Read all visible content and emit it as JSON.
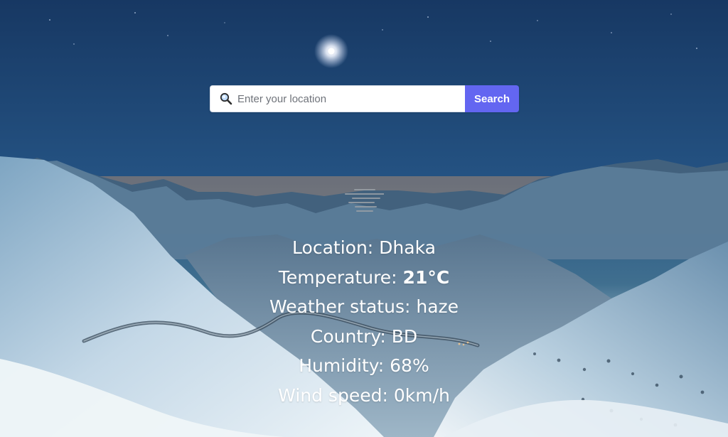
{
  "search": {
    "placeholder": "Enter your location",
    "button_label": "Search"
  },
  "weather": {
    "location_label": "Location: ",
    "location_value": "Dhaka",
    "temperature_label": "Temperature: ",
    "temperature_value": "21°C",
    "status_label": "Weather status: ",
    "status_value": "haze",
    "country_label": "Country: ",
    "country_value": "BD",
    "humidity_label": "Humidity: ",
    "humidity_value": "68%",
    "wind_label": "Wind speed: ",
    "wind_value": "0km/h"
  },
  "icons": {
    "search": "search-icon",
    "weather": "haze-icon"
  },
  "colors": {
    "button": "#6366f1",
    "text": "#ffffff"
  }
}
